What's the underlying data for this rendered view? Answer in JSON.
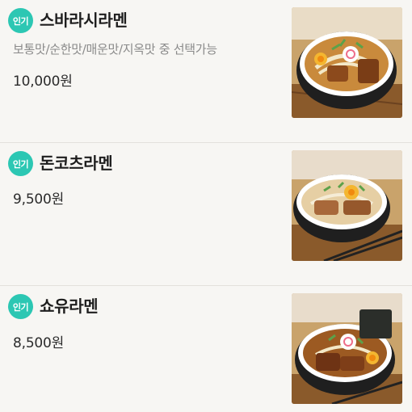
{
  "menu": {
    "items": [
      {
        "badge": "인기",
        "name": "스바라시라멘",
        "options": "보통맛/순한맛/매운맛/지옥맛 중 선택가능",
        "price": "10,000원"
      },
      {
        "badge": "인기",
        "name": "돈코츠라멘",
        "price": "9,500원"
      },
      {
        "badge": "인기",
        "name": "쇼유라멘",
        "price": "8,500원"
      }
    ]
  },
  "colors": {
    "badge": "#2cc7b3",
    "background": "#f7f6f3"
  }
}
